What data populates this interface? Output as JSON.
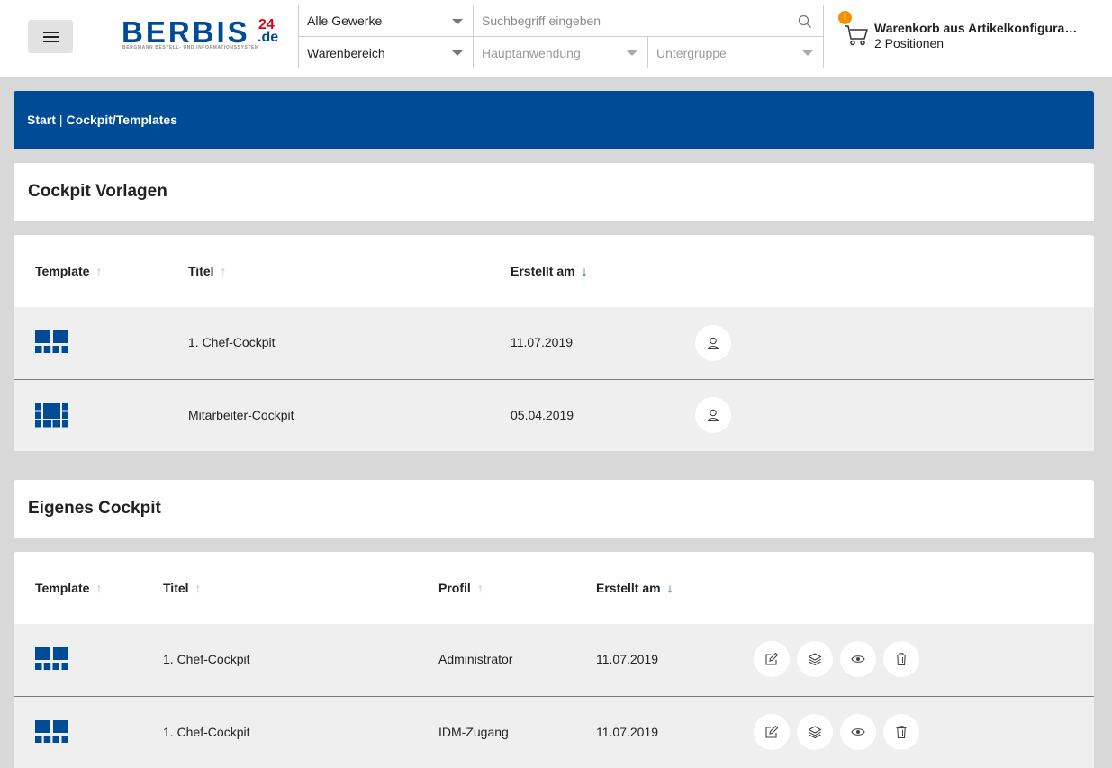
{
  "header": {
    "logo": {
      "main": "BERBIS",
      "sup": "24",
      "tld": ".de",
      "subtitle": "BERGMANN BESTELL- UND INFORMATIONSSYSTEM"
    },
    "search": {
      "gewerke_value": "Alle Gewerke",
      "search_placeholder": "Suchbegriff eingeben",
      "warenbereich_value": "Warenbereich",
      "hauptanwendung_placeholder": "Hauptanwendung",
      "untergruppe_placeholder": "Untergruppe"
    },
    "cart": {
      "badge": "!",
      "title": "Warenkorb aus Artikelkonfigurati...",
      "subtitle": "2 Positionen"
    }
  },
  "breadcrumb": {
    "home": "Start",
    "separator": "|",
    "current": "Cockpit/Templates"
  },
  "vorlagen": {
    "title": "Cockpit Vorlagen",
    "columns": {
      "template": "Template",
      "titel": "Titel",
      "erstellt": "Erstellt am"
    },
    "rows": [
      {
        "template_icon": "layout-2-large-4-small-icon",
        "titel": "1. Chef-Cockpit",
        "erstellt": "11.07.2019"
      },
      {
        "template_icon": "layout-grid-center-icon",
        "titel": "Mitarbeiter-Cockpit",
        "erstellt": "05.04.2019"
      }
    ]
  },
  "eigenes": {
    "title": "Eigenes Cockpit",
    "columns": {
      "template": "Template",
      "titel": "Titel",
      "profil": "Profil",
      "erstellt": "Erstellt am"
    },
    "rows": [
      {
        "template_icon": "layout-2-large-4-small-icon",
        "titel": "1. Chef-Cockpit",
        "profil": "Administrator",
        "erstellt": "11.07.2019"
      },
      {
        "template_icon": "layout-2-large-4-small-icon",
        "titel": "1. Chef-Cockpit",
        "profil": "IDM-Zugang",
        "erstellt": "11.07.2019"
      }
    ]
  },
  "colors": {
    "brand_blue": "#004b96",
    "brand_red": "#e3000f",
    "warning_orange": "#f39200",
    "page_bg": "#d8d8d8",
    "row_bg": "#efefef"
  }
}
